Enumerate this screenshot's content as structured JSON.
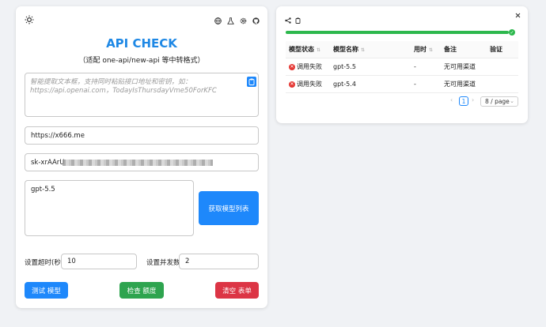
{
  "header": {
    "title": "API CHECK",
    "subtitle": "（适配 one-api/new-api 等中转格式）",
    "icons": [
      "sun-icon",
      "globe-icon",
      "flask-icon",
      "gear-icon",
      "github-icon"
    ]
  },
  "form": {
    "paste_placeholder": "智能提取文本框，支持同时粘贴接口地址和密钥，如：https://api.openai.com，TodayIsThursdayVme50ForKFC",
    "url_value": "https://x666.me",
    "key_value": "sk-xrAArU",
    "models_value": "gpt-5.5",
    "fetch_models_label": "获取模型列表",
    "timeout_label": "设置超时(秒):",
    "timeout_value": "10",
    "concurrency_label": "设置并发数:",
    "concurrency_value": "2"
  },
  "actions": {
    "test_label": "测试 模型",
    "check_quota_label": "检查 额度",
    "clear_label": "清空 表单"
  },
  "results": {
    "progress": 1.0,
    "columns": [
      "模型状态",
      "模型名称",
      "用时",
      "备注",
      "验证"
    ],
    "rows": [
      {
        "status": "调用失败",
        "model": "gpt-5.5",
        "time": "-",
        "note": "无可用渠道",
        "verify": ""
      },
      {
        "status": "调用失败",
        "model": "gpt-5.4",
        "time": "-",
        "note": "无可用渠道",
        "verify": ""
      }
    ],
    "pagination": {
      "current_page": "1",
      "page_size": "8 / page"
    }
  },
  "colors": {
    "primary": "#1e88fb",
    "success": "#2ea44f",
    "danger": "#dc3545",
    "title": "#1e88e5"
  }
}
